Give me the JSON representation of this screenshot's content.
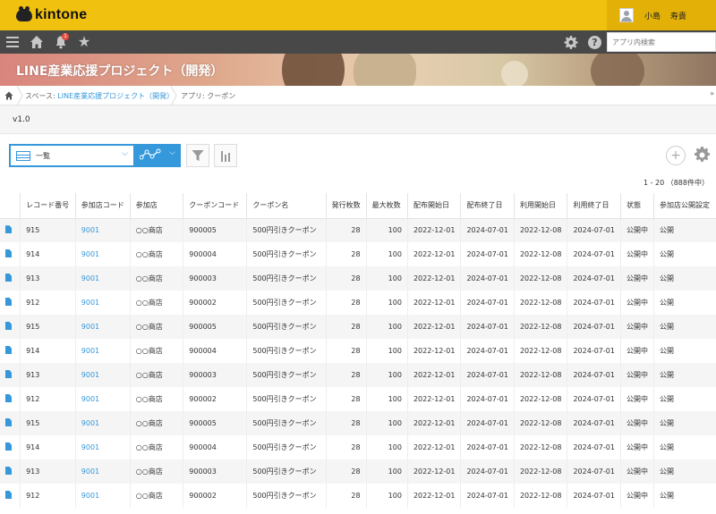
{
  "header": {
    "logo_text": "kintone",
    "user_name": "小島 寿貴"
  },
  "nav": {
    "notification_count": "1",
    "search_placeholder": "アプリ内検索"
  },
  "banner": {
    "title": "LINE産業応援プロジェクト（開発）"
  },
  "breadcrumb": {
    "space_label": "スペース:",
    "space_name": "LINE産業応援プロジェクト（開発）",
    "app_label": "アプリ: クーポン",
    "more": "»"
  },
  "version": "v1.0",
  "toolbar": {
    "view_name": "一覧",
    "pagination": "1 - 20 （888件中）"
  },
  "table": {
    "columns": [
      "",
      "レコード番号",
      "参加店コード",
      "参加店",
      "クーポンコード",
      "クーポン名",
      "発行枚数",
      "最大枚数",
      "配布開始日",
      "配布終了日",
      "利用開始日",
      "利用終了日",
      "状態",
      "参加店公開設定"
    ],
    "rows": [
      {
        "record": "915",
        "shop_code": "9001",
        "shop": "○○商店",
        "coupon_code": "900005",
        "coupon_name": "500円引きクーポン",
        "issued": "28",
        "max": "100",
        "dist_start": "2022-12-01",
        "dist_end": "2024-07-01",
        "use_start": "2022-12-08",
        "use_end": "2024-07-01",
        "status": "公開中",
        "public": "公開"
      },
      {
        "record": "914",
        "shop_code": "9001",
        "shop": "○○商店",
        "coupon_code": "900004",
        "coupon_name": "500円引きクーポン",
        "issued": "28",
        "max": "100",
        "dist_start": "2022-12-01",
        "dist_end": "2024-07-01",
        "use_start": "2022-12-08",
        "use_end": "2024-07-01",
        "status": "公開中",
        "public": "公開"
      },
      {
        "record": "913",
        "shop_code": "9001",
        "shop": "○○商店",
        "coupon_code": "900003",
        "coupon_name": "500円引きクーポン",
        "issued": "28",
        "max": "100",
        "dist_start": "2022-12-01",
        "dist_end": "2024-07-01",
        "use_start": "2022-12-08",
        "use_end": "2024-07-01",
        "status": "公開中",
        "public": "公開"
      },
      {
        "record": "912",
        "shop_code": "9001",
        "shop": "○○商店",
        "coupon_code": "900002",
        "coupon_name": "500円引きクーポン",
        "issued": "28",
        "max": "100",
        "dist_start": "2022-12-01",
        "dist_end": "2024-07-01",
        "use_start": "2022-12-08",
        "use_end": "2024-07-01",
        "status": "公開中",
        "public": "公開"
      },
      {
        "record": "915",
        "shop_code": "9001",
        "shop": "○○商店",
        "coupon_code": "900005",
        "coupon_name": "500円引きクーポン",
        "issued": "28",
        "max": "100",
        "dist_start": "2022-12-01",
        "dist_end": "2024-07-01",
        "use_start": "2022-12-08",
        "use_end": "2024-07-01",
        "status": "公開中",
        "public": "公開"
      },
      {
        "record": "914",
        "shop_code": "9001",
        "shop": "○○商店",
        "coupon_code": "900004",
        "coupon_name": "500円引きクーポン",
        "issued": "28",
        "max": "100",
        "dist_start": "2022-12-01",
        "dist_end": "2024-07-01",
        "use_start": "2022-12-08",
        "use_end": "2024-07-01",
        "status": "公開中",
        "public": "公開"
      },
      {
        "record": "913",
        "shop_code": "9001",
        "shop": "○○商店",
        "coupon_code": "900003",
        "coupon_name": "500円引きクーポン",
        "issued": "28",
        "max": "100",
        "dist_start": "2022-12-01",
        "dist_end": "2024-07-01",
        "use_start": "2022-12-08",
        "use_end": "2024-07-01",
        "status": "公開中",
        "public": "公開"
      },
      {
        "record": "912",
        "shop_code": "9001",
        "shop": "○○商店",
        "coupon_code": "900002",
        "coupon_name": "500円引きクーポン",
        "issued": "28",
        "max": "100",
        "dist_start": "2022-12-01",
        "dist_end": "2024-07-01",
        "use_start": "2022-12-08",
        "use_end": "2024-07-01",
        "status": "公開中",
        "public": "公開"
      },
      {
        "record": "915",
        "shop_code": "9001",
        "shop": "○○商店",
        "coupon_code": "900005",
        "coupon_name": "500円引きクーポン",
        "issued": "28",
        "max": "100",
        "dist_start": "2022-12-01",
        "dist_end": "2024-07-01",
        "use_start": "2022-12-08",
        "use_end": "2024-07-01",
        "status": "公開中",
        "public": "公開"
      },
      {
        "record": "914",
        "shop_code": "9001",
        "shop": "○○商店",
        "coupon_code": "900004",
        "coupon_name": "500円引きクーポン",
        "issued": "28",
        "max": "100",
        "dist_start": "2022-12-01",
        "dist_end": "2024-07-01",
        "use_start": "2022-12-08",
        "use_end": "2024-07-01",
        "status": "公開中",
        "public": "公開"
      },
      {
        "record": "913",
        "shop_code": "9001",
        "shop": "○○商店",
        "coupon_code": "900003",
        "coupon_name": "500円引きクーポン",
        "issued": "28",
        "max": "100",
        "dist_start": "2022-12-01",
        "dist_end": "2024-07-01",
        "use_start": "2022-12-08",
        "use_end": "2024-07-01",
        "status": "公開中",
        "public": "公開"
      },
      {
        "record": "912",
        "shop_code": "9001",
        "shop": "○○商店",
        "coupon_code": "900002",
        "coupon_name": "500円引きクーポン",
        "issued": "28",
        "max": "100",
        "dist_start": "2022-12-01",
        "dist_end": "2024-07-01",
        "use_start": "2022-12-08",
        "use_end": "2024-07-01",
        "status": "公開中",
        "public": "公開"
      }
    ]
  },
  "colors": {
    "header_yellow": "#f1c110",
    "nav_gray": "#484848",
    "accent_blue": "#3498db"
  }
}
